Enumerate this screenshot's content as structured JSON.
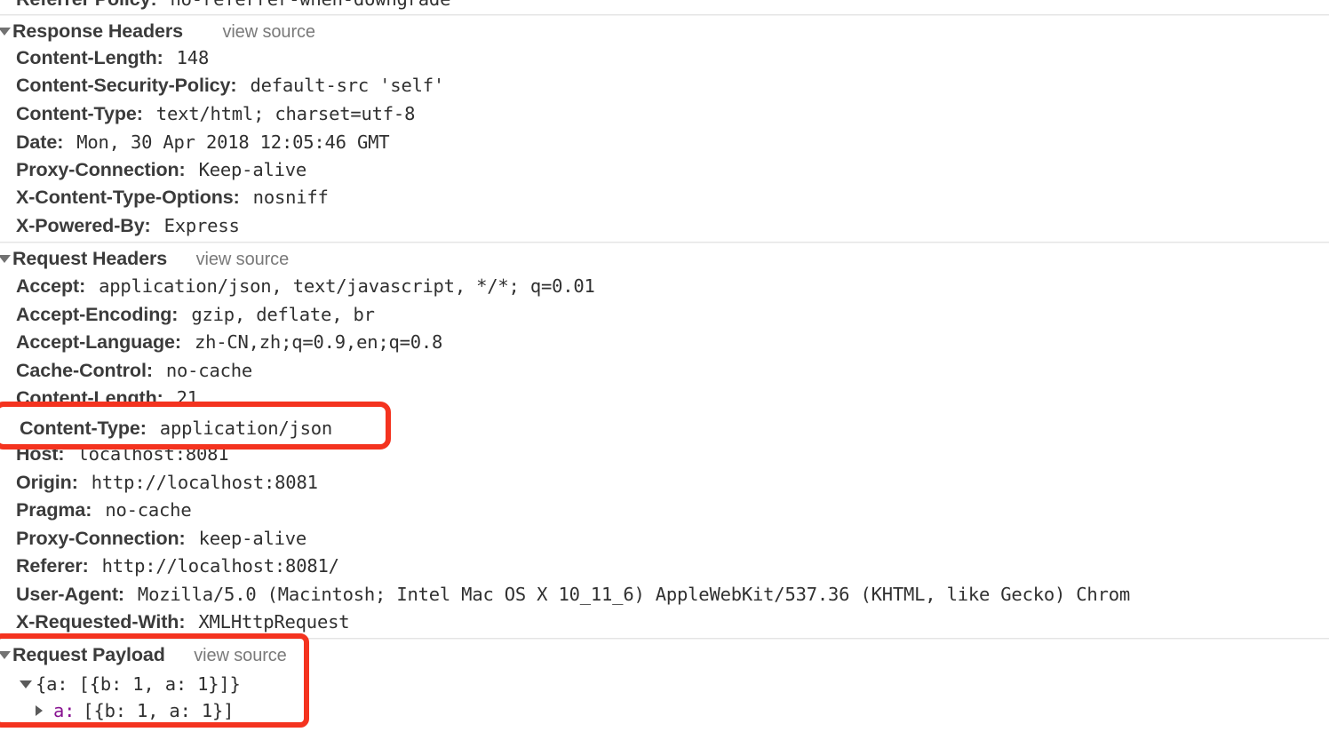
{
  "panel": {
    "name": "chrome-devtools-network-headers-panel",
    "truncated_top_line": {
      "name": "Referrer Policy:",
      "value": "no-referrer-when-downgrade"
    }
  },
  "response_headers": {
    "title": "Response Headers",
    "view_source": "view source",
    "expanded": true,
    "rows": [
      {
        "name": "Content-Length:",
        "value": "148"
      },
      {
        "name": "Content-Security-Policy:",
        "value": "default-src 'self'"
      },
      {
        "name": "Content-Type:",
        "value": "text/html; charset=utf-8"
      },
      {
        "name": "Date:",
        "value": "Mon, 30 Apr 2018 12:05:46 GMT"
      },
      {
        "name": "Proxy-Connection:",
        "value": "Keep-alive"
      },
      {
        "name": "X-Content-Type-Options:",
        "value": "nosniff"
      },
      {
        "name": "X-Powered-By:",
        "value": "Express"
      }
    ]
  },
  "request_headers": {
    "title": "Request Headers",
    "view_source": "view source",
    "expanded": true,
    "rows": [
      {
        "name": "Accept:",
        "value": "application/json, text/javascript, */*; q=0.01"
      },
      {
        "name": "Accept-Encoding:",
        "value": "gzip, deflate, br"
      },
      {
        "name": "Accept-Language:",
        "value": "zh-CN,zh;q=0.9,en;q=0.8"
      },
      {
        "name": "Cache-Control:",
        "value": "no-cache"
      },
      {
        "name": "Content-Length:",
        "value": "21"
      },
      {
        "name": "Content-Type:",
        "value": "application/json"
      },
      {
        "name": "Host:",
        "value": "localhost:8081"
      },
      {
        "name": "Origin:",
        "value": "http://localhost:8081"
      },
      {
        "name": "Pragma:",
        "value": "no-cache"
      },
      {
        "name": "Proxy-Connection:",
        "value": "keep-alive"
      },
      {
        "name": "Referer:",
        "value": "http://localhost:8081/"
      },
      {
        "name": "User-Agent:",
        "value": "Mozilla/5.0 (Macintosh; Intel Mac OS X 10_11_6) AppleWebKit/537.36 (KHTML, like Gecko) Chrom"
      },
      {
        "name": "X-Requested-With:",
        "value": "XMLHttpRequest"
      }
    ]
  },
  "request_payload": {
    "title": "Request Payload",
    "view_source": "view source",
    "expanded": true,
    "root_line": "{a: [{b: 1, a: 1}]}",
    "child": {
      "key": "a:",
      "value": "[{b: 1, a: 1}]"
    }
  },
  "annotations": {
    "highlight_color": "#f4331f",
    "box_content_type": {
      "name": "Content-Type:",
      "value": "application/json"
    },
    "box_payload": {
      "title": "Request Payload",
      "view_source": "view source",
      "root_line": "{a: [{b: 1, a: 1}]}",
      "child_key": "a:",
      "child_value": "[{b: 1, a: 1}]"
    }
  }
}
